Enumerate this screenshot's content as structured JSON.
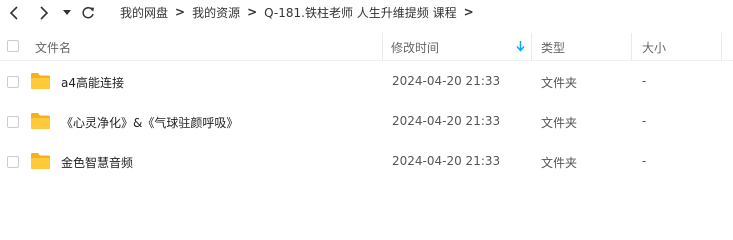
{
  "nav": {
    "back_icon": "chevron-left-icon",
    "forward_icon": "chevron-right-icon",
    "history_icon": "caret-down-icon",
    "refresh_icon": "refresh-icon"
  },
  "breadcrumb": [
    "我的网盘",
    "我的资源",
    "Q-181.铁柱老师 人生升维提频 课程"
  ],
  "breadcrumb_separator": ">",
  "header": {
    "name": "文件名",
    "modified": "修改时间",
    "type": "类型",
    "size": "大小",
    "sort_icon": "sort-down-arrow-icon"
  },
  "rows": [
    {
      "name": "a4高能连接",
      "modified": "2024-04-20 21:33",
      "type": "文件夹",
      "size": "-"
    },
    {
      "name": "《心灵净化》&《气球驻颜呼吸》",
      "modified": "2024-04-20 21:33",
      "type": "文件夹",
      "size": "-"
    },
    {
      "name": "金色智慧音频",
      "modified": "2024-04-20 21:33",
      "type": "文件夹",
      "size": "-"
    }
  ],
  "colors": {
    "folder": "#ffc93c",
    "folder_dark": "#f4b223",
    "accent": "#06a7ff",
    "text": "#333333"
  }
}
